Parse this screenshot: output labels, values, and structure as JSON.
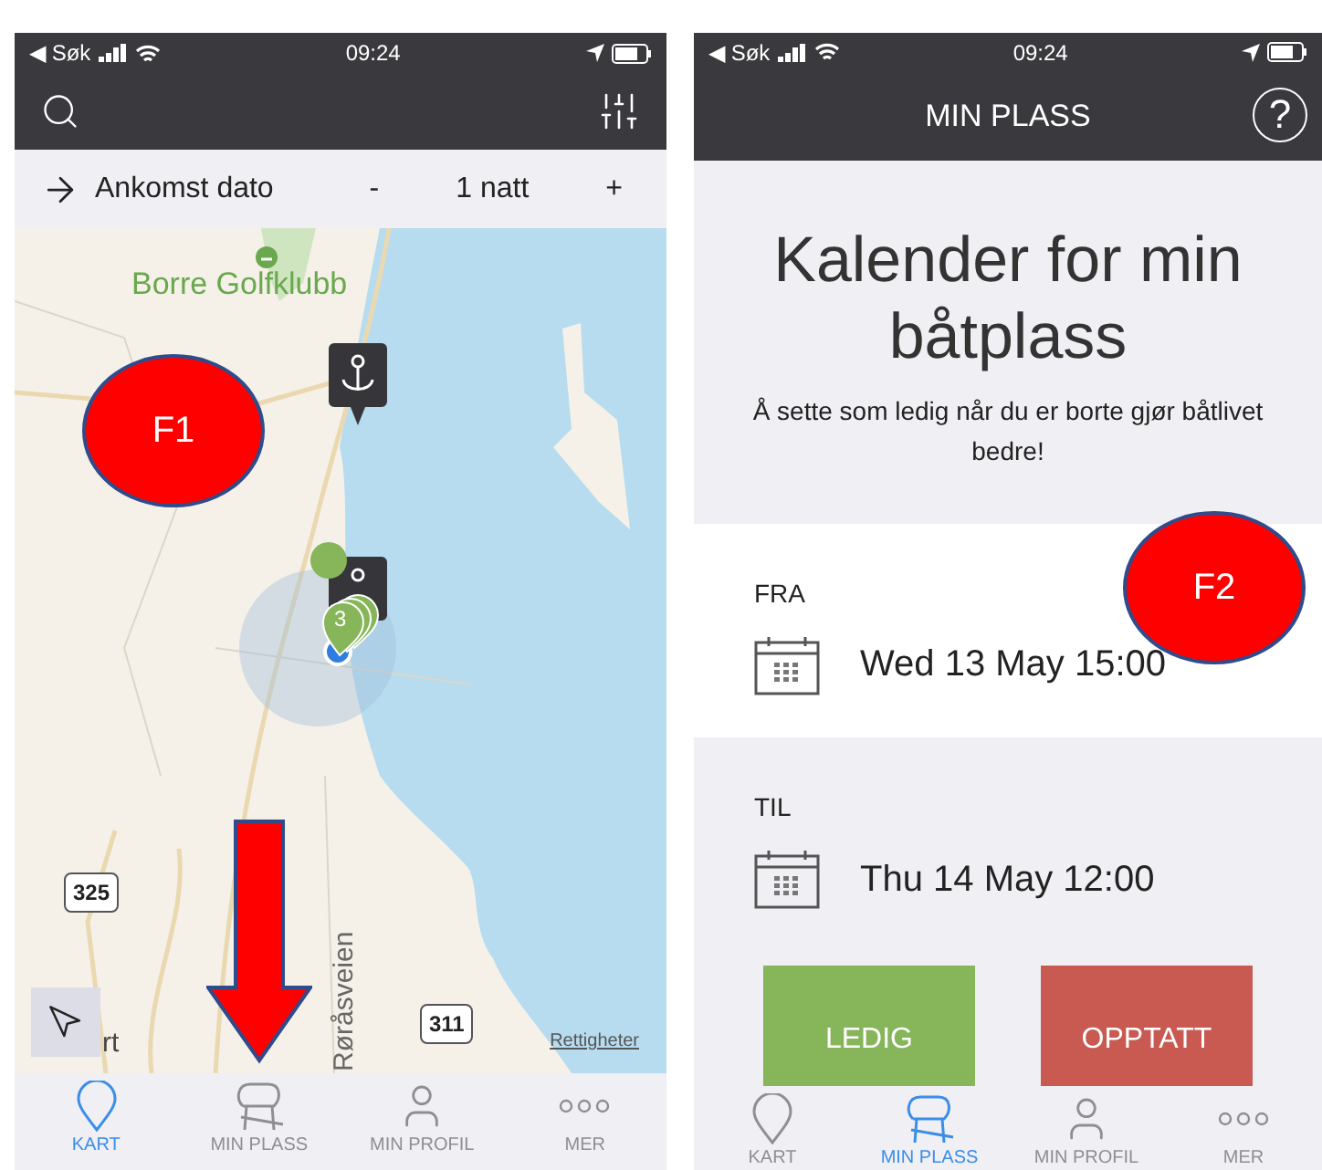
{
  "left_screen": {
    "status_bar": {
      "back": "◀ Søk",
      "time": "09:24"
    },
    "filter_bar": {
      "label": "Ankomst dato",
      "minus": "-",
      "nights": "1 natt",
      "plus": "+"
    },
    "map": {
      "place_label": "Borre Golfklubb",
      "road_label": "Røråsveien",
      "route_shields": [
        "325",
        "311"
      ],
      "partial_label": "rt",
      "cluster_count": "3",
      "attribution": "Rettigheter"
    },
    "tab_bar": [
      {
        "kind": "pin",
        "label": "KART",
        "selected": true
      },
      {
        "kind": "chair",
        "label": "MIN PLASS",
        "selected": false
      },
      {
        "kind": "person",
        "label": "MIN PROFIL",
        "selected": false
      },
      {
        "kind": "more",
        "label": "MER",
        "selected": false
      }
    ]
  },
  "right_screen": {
    "status_bar": {
      "back": "◀ Søk",
      "time": "09:24"
    },
    "header": {
      "title": "MIN PLASS",
      "help": "?"
    },
    "intro": {
      "title": "Kalender for min båtplass",
      "text": "Å sette som ledig når du er borte gjør båtlivet bedre!"
    },
    "dates": [
      {
        "label": "FRA",
        "value": "Wed 13 May 15:00"
      },
      {
        "label": "TIL",
        "value": "Thu 14 May 12:00"
      }
    ],
    "buttons": [
      {
        "label": "LEDIG",
        "color": "#86b55a"
      },
      {
        "label": "OPPTATT",
        "color": "#c85a52"
      }
    ],
    "tab_bar": [
      {
        "kind": "pin",
        "label": "KART",
        "selected": false
      },
      {
        "kind": "chair",
        "label": "MIN PLASS",
        "selected": true
      },
      {
        "kind": "person",
        "label": "MIN PROFIL",
        "selected": false
      },
      {
        "kind": "more",
        "label": "MER",
        "selected": false
      }
    ]
  },
  "annotations": [
    {
      "label": "F1"
    },
    {
      "label": "F2"
    }
  ]
}
